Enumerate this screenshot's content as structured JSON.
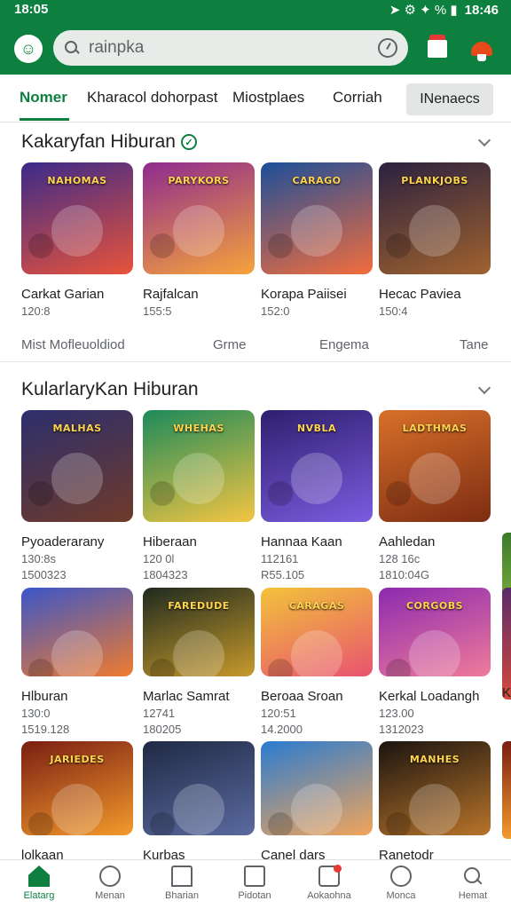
{
  "status": {
    "time_left": "18:05",
    "time_right": "18:46",
    "glyphs": "➤ ⚙ ✦ % ▮"
  },
  "search": {
    "value": "rainpka"
  },
  "tabs": [
    {
      "label": "Nomer",
      "active": true
    },
    {
      "label": "Kharacol dohorpast"
    },
    {
      "label": "Miostplaes"
    },
    {
      "label": "Corriah"
    },
    {
      "label": "INenaecs"
    }
  ],
  "section1": {
    "title": "Kakaryfan Hiburan",
    "items": [
      {
        "title": "Carkat Garian",
        "sub": "120:8",
        "art": "NAHOMAS",
        "c1": "#3b2a8a",
        "c2": "#e8533a"
      },
      {
        "title": "Rajfalcan",
        "sub": "155:5",
        "art": "PARYKORS",
        "c1": "#8e2b8f",
        "c2": "#f6a33b"
      },
      {
        "title": "Korapa Paiisei",
        "sub": "152:0",
        "art": "CARAGO",
        "c1": "#1d4e9a",
        "c2": "#f26d3d"
      },
      {
        "title": "Hecac Paviea",
        "sub": "150:4",
        "art": "PLANKJOBS",
        "c1": "#2b2140",
        "c2": "#a0622e"
      }
    ],
    "categories": [
      "Mist Mofleuoldiod",
      "Grme",
      "Engema",
      "Tane"
    ]
  },
  "section2": {
    "title": "KularlaryKan Hiburan",
    "rows": [
      [
        {
          "title": "Pyoaderarany",
          "sub": "130:8s",
          "sub2": "1500323",
          "art": "MALHAS",
          "c1": "#2c2f6d",
          "c2": "#6f3a2a"
        },
        {
          "title": "Hiberaan",
          "sub": "120 0l",
          "sub2": "1804323",
          "art": "WHEHAS",
          "c1": "#1c8a5a",
          "c2": "#f4c542"
        },
        {
          "title": "Hannaa Kaan",
          "sub": "112161",
          "sub2": "R55.105",
          "art": "NVBLA",
          "c1": "#2e1f6e",
          "c2": "#7b5ce0"
        },
        {
          "title": "Aahledan",
          "sub": "128 16c",
          "sub2": "1810:04G",
          "art": "LADTHMAS",
          "c1": "#d8702a",
          "c2": "#7d2c12"
        }
      ],
      [
        {
          "title": "Hlburan",
          "sub": "130:0",
          "sub2": "1519.128",
          "art": "",
          "c1": "#3a56c9",
          "c2": "#f07b2e"
        },
        {
          "title": "Marlac Samrat",
          "sub": "12741",
          "sub2": "180205",
          "art": "FAREDUDE",
          "c1": "#1f2a1f",
          "c2": "#c79a2b"
        },
        {
          "title": "Beroaa Sroan",
          "sub": "120:51",
          "sub2": "14.2000",
          "art": "CARAGAS",
          "c1": "#f2c33a",
          "c2": "#e8536f"
        },
        {
          "title": "Kerkal Loadangh",
          "sub": "123.00",
          "sub2": "1312023",
          "art": "CORGOBS",
          "c1": "#8c2ab0",
          "c2": "#ef7b9a"
        }
      ],
      [
        {
          "title": "lolkaan",
          "sub": "",
          "sub2": "",
          "art": "JARIEDES",
          "c1": "#7a1e12",
          "c2": "#f39a2c"
        },
        {
          "title": "Kurbas",
          "sub": "",
          "sub2": "",
          "art": "",
          "c1": "#202a44",
          "c2": "#5a6aa0"
        },
        {
          "title": "Canel dars",
          "sub": "",
          "sub2": "",
          "art": "",
          "c1": "#2b7bd1",
          "c2": "#f1a55a"
        },
        {
          "title": "Ranetodr",
          "sub": "",
          "sub2": "",
          "art": "MANHES",
          "c1": "#1b1410",
          "c2": "#b8742a"
        }
      ]
    ],
    "peek_labels": [
      "K"
    ]
  },
  "bottom_nav": [
    {
      "label": "Elatarg",
      "icon": "home-icon",
      "active": true
    },
    {
      "label": "Menan",
      "icon": "face-icon"
    },
    {
      "label": "Bharian",
      "icon": "store-icon"
    },
    {
      "label": "Pidotan",
      "icon": "box-icon"
    },
    {
      "label": "Aokaohna",
      "icon": "notification-icon"
    },
    {
      "label": "Monca",
      "icon": "circle-icon"
    },
    {
      "label": "Hemat",
      "icon": "search-icon"
    }
  ],
  "colors": {
    "brand": "#0d7f3f",
    "badge": "#e53935"
  }
}
